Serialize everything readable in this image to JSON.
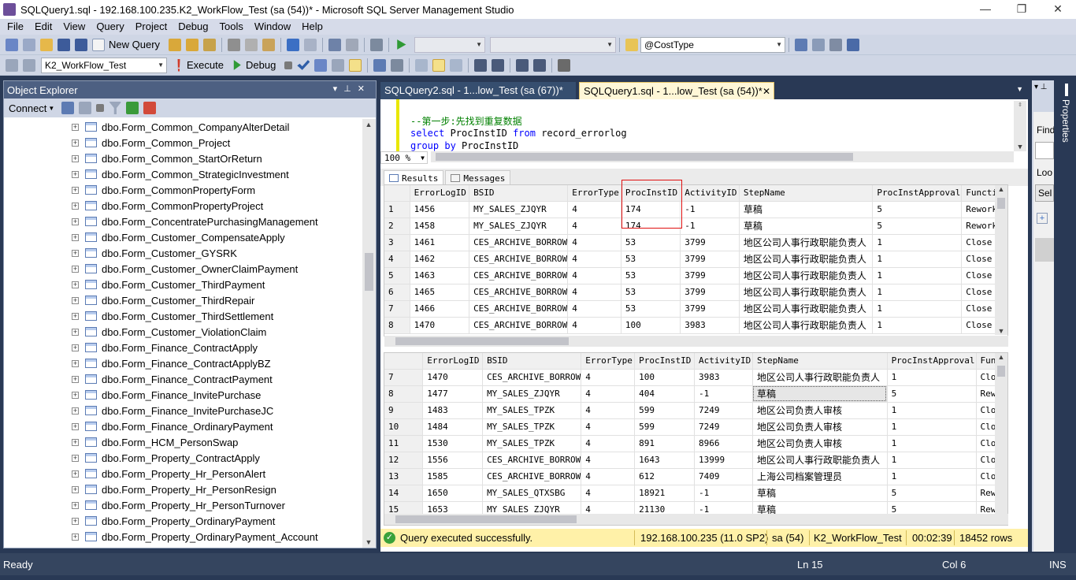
{
  "window": {
    "title": "SQLQuery1.sql - 192.168.100.235.K2_WorkFlow_Test (sa (54))* - Microsoft SQL Server Management Studio"
  },
  "menu": [
    "File",
    "Edit",
    "View",
    "Query",
    "Project",
    "Debug",
    "Tools",
    "Window",
    "Help"
  ],
  "toolbar1": {
    "new_query": "New Query",
    "param_combo": "@CostType"
  },
  "toolbar2": {
    "database": "K2_WorkFlow_Test",
    "execute": "Execute",
    "debug": "Debug"
  },
  "object_explorer": {
    "title": "Object Explorer",
    "connect": "Connect",
    "items": [
      "dbo.Form_Common_CompanyAlterDetail",
      "dbo.Form_Common_Project",
      "dbo.Form_Common_StartOrReturn",
      "dbo.Form_Common_StrategicInvestment",
      "dbo.Form_CommonPropertyForm",
      "dbo.Form_CommonPropertyProject",
      "dbo.Form_ConcentratePurchasingManagement",
      "dbo.Form_Customer_CompensateApply",
      "dbo.Form_Customer_GYSRK",
      "dbo.Form_Customer_OwnerClaimPayment",
      "dbo.Form_Customer_ThirdPayment",
      "dbo.Form_Customer_ThirdRepair",
      "dbo.Form_Customer_ThirdSettlement",
      "dbo.Form_Customer_ViolationClaim",
      "dbo.Form_Finance_ContractApply",
      "dbo.Form_Finance_ContractApplyBZ",
      "dbo.Form_Finance_ContractPayment",
      "dbo.Form_Finance_InvitePurchase",
      "dbo.Form_Finance_InvitePurchaseJC",
      "dbo.Form_Finance_OrdinaryPayment",
      "dbo.Form_HCM_PersonSwap",
      "dbo.Form_Property_ContractApply",
      "dbo.Form_Property_Hr_PersonAlert",
      "dbo.Form_Property_Hr_PersonResign",
      "dbo.Form_Property_Hr_PersonTurnover",
      "dbo.Form_Property_OrdinaryPayment",
      "dbo.Form_Property_OrdinaryPayment_Account"
    ]
  },
  "tabs": [
    {
      "label": "SQLQuery2.sql - 1...low_Test (sa (67))*"
    },
    {
      "label": "SQLQuery1.sql - 1...low_Test (sa (54))*"
    }
  ],
  "editor": {
    "line1_comment": "--第一步:先找到重复数据",
    "line2_kw1": "select",
    "line2_rest": " ProcInstID ",
    "line2_kw2": "from",
    "line2_tail": " record_errorlog",
    "line3_kw": "group by",
    "line3_rest": " ProcInstID",
    "zoom": "100 %"
  },
  "result_tabs": {
    "results": "Results",
    "messages": "Messages"
  },
  "grid1": {
    "columns": [
      "",
      "ErrorLogID",
      "BSID",
      "ErrorType",
      "ProcInstID",
      "ActivityID",
      "StepName",
      "ProcInstApproval",
      "Functi"
    ],
    "rows": [
      [
        "1",
        "1456",
        "MY_SALES_ZJQYR",
        "4",
        "174",
        "-1",
        "草稿",
        "5",
        "Rework"
      ],
      [
        "2",
        "1458",
        "MY_SALES_ZJQYR",
        "4",
        "174",
        "-1",
        "草稿",
        "5",
        "Rework"
      ],
      [
        "3",
        "1461",
        "CES_ARCHIVE_BORROW",
        "4",
        "53",
        "3799",
        "地区公司人事行政职能负责人",
        "1",
        "Close"
      ],
      [
        "4",
        "1462",
        "CES_ARCHIVE_BORROW",
        "4",
        "53",
        "3799",
        "地区公司人事行政职能负责人",
        "1",
        "Close"
      ],
      [
        "5",
        "1463",
        "CES_ARCHIVE_BORROW",
        "4",
        "53",
        "3799",
        "地区公司人事行政职能负责人",
        "1",
        "Close"
      ],
      [
        "6",
        "1465",
        "CES_ARCHIVE_BORROW",
        "4",
        "53",
        "3799",
        "地区公司人事行政职能负责人",
        "1",
        "Close"
      ],
      [
        "7",
        "1466",
        "CES_ARCHIVE_BORROW",
        "4",
        "53",
        "3799",
        "地区公司人事行政职能负责人",
        "1",
        "Close"
      ],
      [
        "8",
        "1470",
        "CES_ARCHIVE_BORROW",
        "4",
        "100",
        "3983",
        "地区公司人事行政职能负责人",
        "1",
        "Close"
      ]
    ]
  },
  "grid2": {
    "columns": [
      "",
      "ErrorLogID",
      "BSID",
      "ErrorType",
      "ProcInstID",
      "ActivityID",
      "StepName",
      "ProcInstApproval",
      "Fun"
    ],
    "rows": [
      [
        "7",
        "1470",
        "CES_ARCHIVE_BORROW",
        "4",
        "100",
        "3983",
        "地区公司人事行政职能负责人",
        "1",
        "Clo"
      ],
      [
        "8",
        "1477",
        "MY_SALES_ZJQYR",
        "4",
        "404",
        "-1",
        "草稿",
        "5",
        "Rew"
      ],
      [
        "9",
        "1483",
        "MY_SALES_TPZK",
        "4",
        "599",
        "7249",
        "地区公司负责人审核",
        "1",
        "Clo"
      ],
      [
        "10",
        "1484",
        "MY_SALES_TPZK",
        "4",
        "599",
        "7249",
        "地区公司负责人审核",
        "1",
        "Clo"
      ],
      [
        "11",
        "1530",
        "MY_SALES_TPZK",
        "4",
        "891",
        "8966",
        "地区公司负责人审核",
        "1",
        "Clo"
      ],
      [
        "12",
        "1556",
        "CES_ARCHIVE_BORROW",
        "4",
        "1643",
        "13999",
        "地区公司人事行政职能负责人",
        "1",
        "Clo"
      ],
      [
        "13",
        "1585",
        "CES_ARCHIVE_BORROW",
        "4",
        "612",
        "7409",
        "上海公司档案管理员",
        "1",
        "Clo"
      ],
      [
        "14",
        "1650",
        "MY_SALES_QTXSBG",
        "4",
        "18921",
        "-1",
        "草稿",
        "5",
        "Rew"
      ],
      [
        "15",
        "1653",
        "MY_SALES_ZJQYR",
        "4",
        "21130",
        "-1",
        "草稿",
        "5",
        "Rew"
      ]
    ]
  },
  "query_status": {
    "message": "Query executed successfully.",
    "server": "192.168.100.235 (11.0 SP2)",
    "user": "sa (54)",
    "database": "K2_WorkFlow_Test",
    "elapsed": "00:02:39",
    "rows": "18452 rows"
  },
  "right_panel": {
    "properties": "Properties",
    "find": "Find",
    "look": "Loo",
    "sel": "Sel"
  },
  "status": {
    "ready": "Ready",
    "ln": "Ln 15",
    "col": "Col 6",
    "ins": "INS"
  }
}
